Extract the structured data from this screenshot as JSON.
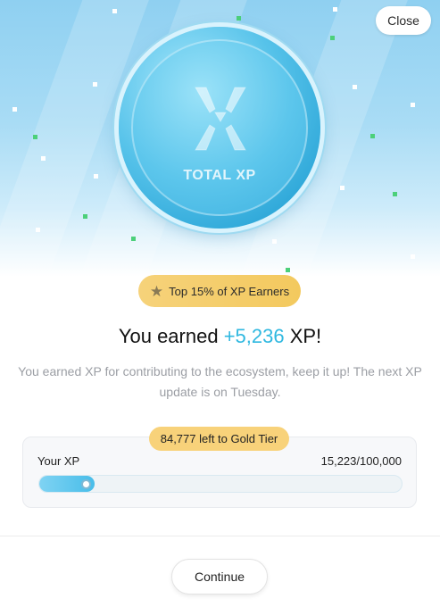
{
  "header": {
    "close_label": "Close"
  },
  "coin": {
    "label": "TOTAL XP",
    "icon": "xp-emblem-icon"
  },
  "rank_badge": {
    "icon": "star-icon",
    "text": "Top 15% of XP Earners"
  },
  "headline": {
    "prefix": "You earned ",
    "amount": "+5,236",
    "suffix": " XP!"
  },
  "description": "You earned XP for contributing to the ecosystem, keep it up! The next XP update is on Tuesday.",
  "xp_progress": {
    "remaining_label": "84,777 left to Gold Tier",
    "label": "Your XP",
    "value_text": "15,223/100,000",
    "current": 15223,
    "max": 100000
  },
  "footer": {
    "continue_label": "Continue"
  },
  "colors": {
    "accent": "#2fb8e0",
    "badge_gold": "#f6d27a",
    "progress_fill": "#48bde9"
  }
}
